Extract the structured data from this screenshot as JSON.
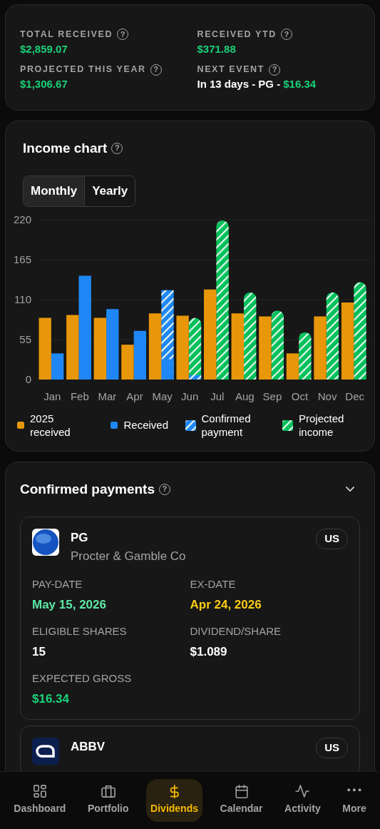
{
  "summary": {
    "stats": [
      {
        "label": "TOTAL RECEIVED",
        "hint": "?",
        "value": "$2,859.07"
      },
      {
        "label": "RECEIVED YTD",
        "hint": "?",
        "value": "$371.88"
      },
      {
        "label": "PROJECTED THIS YEAR",
        "hint": "?",
        "value": "$1,306.67"
      },
      {
        "label": "NEXT EVENT",
        "hint": "?",
        "value": "In 13 days - PG -",
        "amount": "$16.34"
      }
    ]
  },
  "income_chart": {
    "title": "Income chart",
    "hint": "?",
    "toggle": [
      {
        "label": "Monthly",
        "selected": true
      },
      {
        "label": "Yearly",
        "selected": false
      }
    ],
    "chart_data": {
      "type": "bar",
      "grid": true,
      "categories": [
        "Jan",
        "Feb",
        "Mar",
        "Apr",
        "May",
        "Jun",
        "Jul",
        "Aug",
        "Sep",
        "Oct",
        "Nov",
        "Dec"
      ],
      "ylim": [
        0,
        220
      ],
      "yticks": [
        0,
        55,
        110,
        165,
        220
      ],
      "series": [
        {
          "name": "2025 received",
          "color": "#e8960a",
          "values": [
            85,
            89,
            85,
            48,
            91,
            88,
            124,
            91,
            87,
            36,
            87,
            106
          ]
        },
        {
          "name": "Received",
          "color": "#1f87f5",
          "values": [
            36,
            143,
            97,
            67,
            28,
            null,
            null,
            null,
            null,
            null,
            null,
            null
          ]
        },
        {
          "name": "Confirmed payment",
          "color": "#1f87f5",
          "values": [
            null,
            null,
            null,
            null,
            123,
            6,
            null,
            null,
            null,
            null,
            null,
            null
          ]
        },
        {
          "name": "Projected income",
          "color": "#00c05a",
          "values": [
            null,
            null,
            null,
            null,
            null,
            85,
            219,
            120,
            95,
            65,
            120,
            134
          ]
        }
      ]
    }
  },
  "confirmed_payments": {
    "title": "Confirmed payments",
    "hint": "?",
    "expanded": true,
    "items": [
      {
        "ticker": "PG",
        "company": "Procter & Gamble Co",
        "market": "US",
        "fields": [
          {
            "label": "PAY-DATE",
            "value": "May 15, 2026",
            "color": "#5ee8a6"
          },
          {
            "label": "EX-DATE",
            "value": "Apr 24, 2026",
            "color": "#facc15"
          },
          {
            "label": "ELIGIBLE SHARES",
            "value": "15",
            "color": "#ffffff"
          },
          {
            "label": "DIVIDEND/SHARE",
            "value": "$1.089",
            "color": "#ffffff"
          },
          {
            "label": "EXPECTED GROSS",
            "value": "$16.34",
            "color": "#19d17a"
          }
        ]
      },
      {
        "ticker": "ABBV",
        "market": "US"
      }
    ]
  },
  "bottom_nav": [
    {
      "label": "Dashboard",
      "selected": false
    },
    {
      "label": "Portfolio",
      "selected": false
    },
    {
      "label": "Dividends",
      "selected": true
    },
    {
      "label": "Calendar",
      "selected": false
    },
    {
      "label": "Activity",
      "selected": false
    },
    {
      "label": "More",
      "selected": false
    }
  ]
}
